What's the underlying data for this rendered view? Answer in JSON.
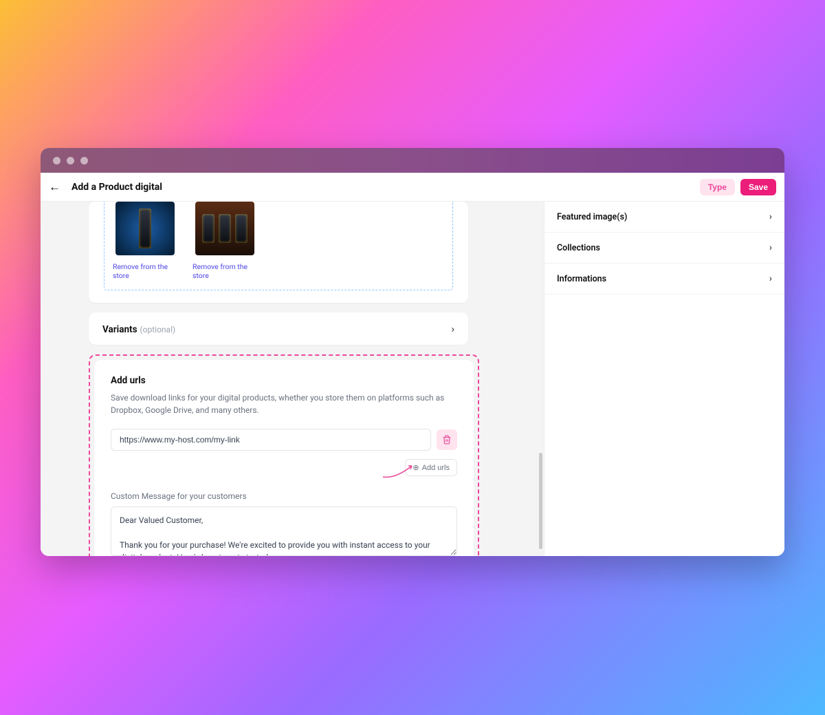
{
  "header": {
    "page_title": "Add a Product digital",
    "type_btn": "Type",
    "save_btn": "Save"
  },
  "media": {
    "remove_link": "Remove from the store"
  },
  "variants": {
    "title": "Variants",
    "optional": "(optional)"
  },
  "urls": {
    "title": "Add urls",
    "desc": "Save download links for your digital products, whether you store them on platforms such as Dropbox, Google Drive, and many others.",
    "value": "https://www.my-host.com/my-link",
    "add_btn": "Add urls",
    "msg_label": "Custom Message for your customers",
    "msg_value": "Dear Valued Customer,\n\nThank you for your purchase! We're excited to provide you with instant access to your digital product. Here's how to get started:"
  },
  "sidebar": {
    "items": [
      {
        "label": "Featured image(s)"
      },
      {
        "label": "Collections"
      },
      {
        "label": "Informations"
      }
    ]
  }
}
